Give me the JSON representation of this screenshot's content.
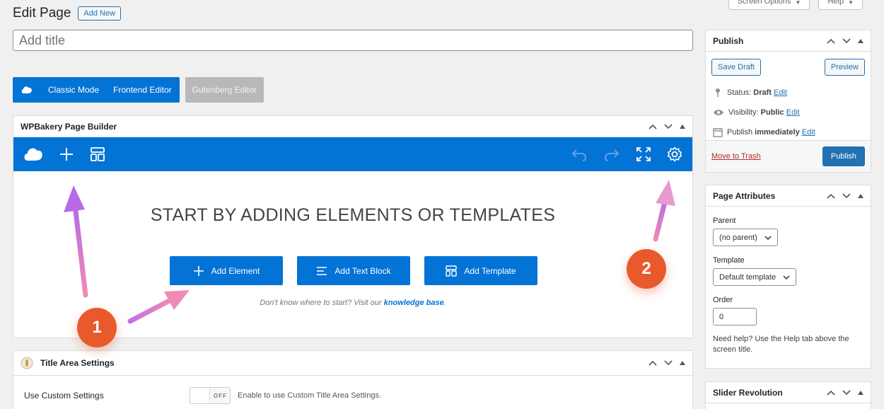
{
  "screen_tabs": {
    "options": "Screen Options",
    "help": "Help"
  },
  "header": {
    "title": "Edit Page",
    "add_new": "Add New"
  },
  "title_input": {
    "placeholder": "Add title"
  },
  "modes": {
    "classic": "Classic Mode",
    "frontend": "Frontend Editor",
    "gutenberg": "Gutenberg Editor"
  },
  "wpbakery": {
    "title": "WPBakery Page Builder",
    "heading": "START BY ADDING ELEMENTS OR TEMPLATES",
    "add_element": "Add Element",
    "add_text_block": "Add Text Block",
    "add_template": "Add Template",
    "hint_prefix": "Don't know where to start? Visit our ",
    "hint_link": "knowledge base",
    "hint_suffix": "."
  },
  "title_area": {
    "title": "Title Area Settings",
    "row_label": "Use Custom Settings",
    "toggle_text": "OFF",
    "description": "Enable to use Custom Title Area Settings."
  },
  "publish": {
    "title": "Publish",
    "save_draft": "Save Draft",
    "preview": "Preview",
    "status_label": "Status: ",
    "status_value": "Draft",
    "visibility_label": "Visibility: ",
    "visibility_value": "Public",
    "publish_label": "Publish ",
    "publish_value": "immediately",
    "edit": "Edit",
    "trash": "Move to Trash",
    "publish_button": "Publish"
  },
  "page_attributes": {
    "title": "Page Attributes",
    "parent_label": "Parent",
    "parent_value": "(no parent)",
    "template_label": "Template",
    "template_value": "Default template",
    "order_label": "Order",
    "order_value": "0",
    "help": "Need help? Use the Help tab above the screen title."
  },
  "slider_revolution": {
    "title": "Slider Revolution"
  },
  "badges": {
    "one": "1",
    "two": "2"
  },
  "colors": {
    "wpb_blue": "#0473d6",
    "wp_blue": "#2271b1",
    "badge": "#e85a2c",
    "arrow": "#c86fe0"
  }
}
